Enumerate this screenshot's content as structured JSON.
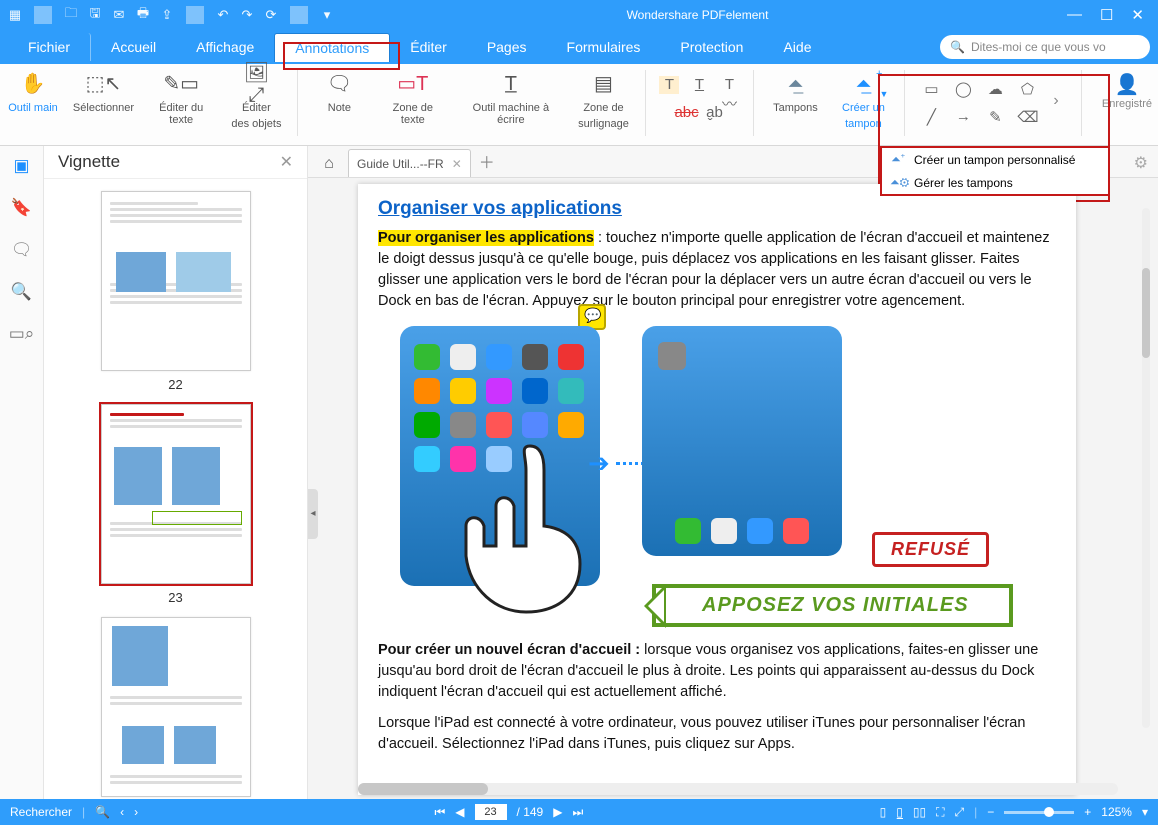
{
  "app": {
    "title": "Wondershare PDFelement"
  },
  "menu": {
    "file": "Fichier",
    "tabs": [
      "Accueil",
      "Affichage",
      "Annotations",
      "Éditer",
      "Pages",
      "Formulaires",
      "Protection",
      "Aide"
    ],
    "active_index": 2,
    "search_placeholder": "Dites-moi ce que vous vo"
  },
  "ribbon": {
    "hand": "Outil main",
    "select": "Sélectionner",
    "edit_text": "Éditer du texte",
    "edit_obj_l1": "Éditer",
    "edit_obj_l2": "des objets",
    "note": "Note",
    "textbox": "Zone de texte",
    "typewriter": "Outil machine à écrire",
    "highlight_l1": "Zone de",
    "highlight_l2": "surlignage",
    "stamps": "Tampons",
    "create_stamp_l1": "Créer un",
    "create_stamp_l2": "tampon",
    "registered": "Enregistré"
  },
  "stamp_menu": {
    "create": "Créer un tampon personnalisé",
    "manage": "Gérer les tampons"
  },
  "side": {
    "panel_title": "Vignette",
    "pages": [
      "22",
      "23"
    ]
  },
  "doc": {
    "tab_label": "Guide Util...--FR",
    "h2": "Organiser vos applications",
    "lead_hl": "Pour organiser les applications",
    "p1_tail": " : touchez n'importe quelle application de l'écran d'accueil et maintenez le doigt dessus jusqu'à ce qu'elle bouge, puis déplacez vos applications en les faisant glisser. Faites glisser une application vers le bord de l'écran pour la déplacer vers un autre écran d'accueil ou vers le Dock en bas de l'écran. Appuyez sur le bouton principal pour enregistrer votre agencement.",
    "p2_lead": "Pour créer un nouvel écran d'accueil :",
    "p2_tail": " lorsque vous organisez vos applications, faites-en glisser une jusqu'au bord droit de l'écran d'accueil le plus à droite. Les points qui apparaissent au-dessus du Dock indiquent l'écran d'accueil qui est actuellement affiché.",
    "p3": "Lorsque l'iPad est connecté à votre ordinateur, vous pouvez utiliser iTunes pour personnaliser l'écran d'accueil. Sélectionnez l'iPad dans iTunes, puis cliquez sur Apps.",
    "stamp_refuse": "REFUSÉ",
    "stamp_init": "APPOSEZ VOS INITIALES"
  },
  "status": {
    "find": "Rechercher",
    "page_current": "23",
    "page_total": "/ 149",
    "zoom": "125%"
  }
}
